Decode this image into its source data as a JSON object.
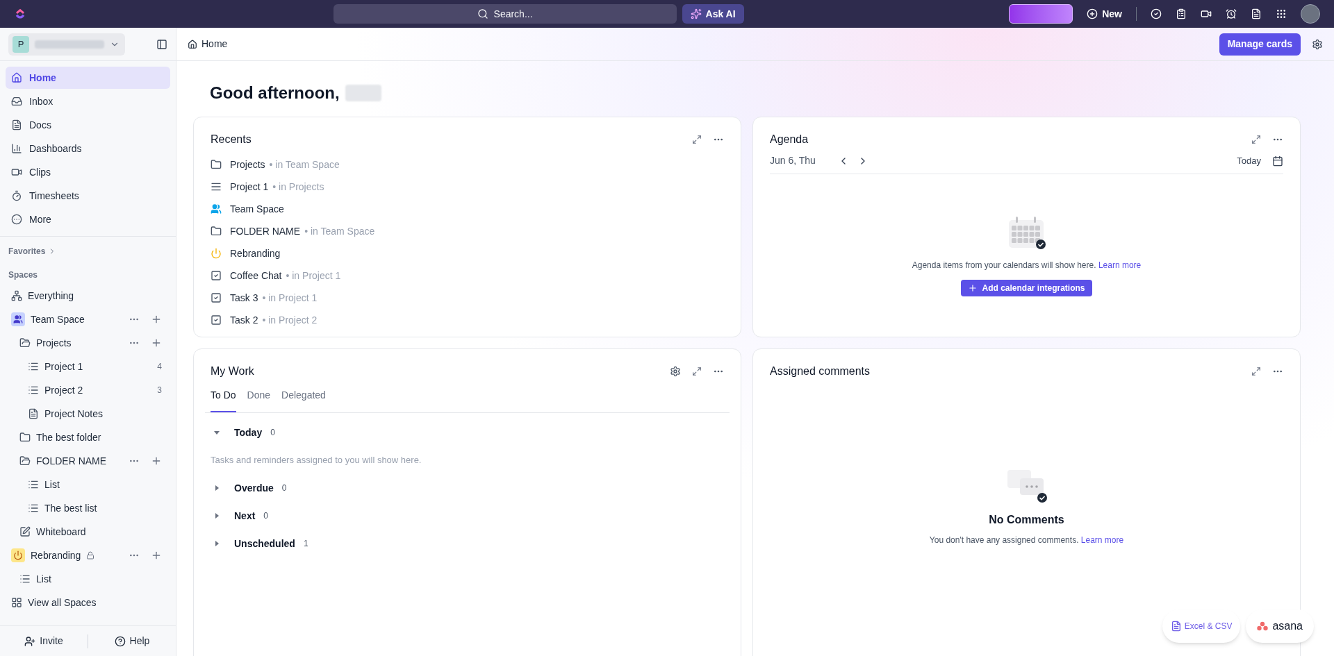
{
  "topbar": {
    "search": {
      "placeholder": "Search..."
    },
    "ask_ai": "Ask AI",
    "new": "New"
  },
  "sidebar": {
    "workspace": {
      "initial": "P"
    },
    "nav": [
      {
        "label": "Home",
        "kind": "home",
        "selected": true
      },
      {
        "label": "Inbox",
        "kind": "inbox",
        "selected": false
      },
      {
        "label": "Docs",
        "kind": "doc",
        "selected": false
      },
      {
        "label": "Dashboards",
        "kind": "chart",
        "selected": false
      },
      {
        "label": "Clips",
        "kind": "video",
        "selected": false
      },
      {
        "label": "Timesheets",
        "kind": "timer",
        "selected": false
      },
      {
        "label": "More",
        "kind": "more",
        "selected": false
      }
    ],
    "favorites": "Favorites",
    "spaces": "Spaces",
    "tree": [
      {
        "label": "Everything",
        "kind": "everything",
        "actions": false,
        "locked": false
      },
      {
        "label": "Team Space",
        "kind": "team",
        "actions": true,
        "locked": false,
        "children": [
          {
            "label": "Projects",
            "kind": "folder",
            "expanded": true,
            "actions": true,
            "locked": false,
            "children": [
              {
                "label": "Project 1",
                "kind": "list",
                "count": "4",
                "actions": false,
                "locked": false
              },
              {
                "label": "Project 2",
                "kind": "list",
                "count": "3",
                "actions": false,
                "locked": false
              },
              {
                "label": "Project Notes",
                "kind": "doc",
                "actions": false,
                "locked": false
              }
            ]
          },
          {
            "label": "The best folder",
            "kind": "folder",
            "expanded": false,
            "actions": false,
            "locked": false
          },
          {
            "label": "FOLDER NAME",
            "kind": "folder",
            "expanded": true,
            "actions": true,
            "locked": false,
            "children": [
              {
                "label": "List",
                "kind": "list",
                "actions": false,
                "locked": false
              },
              {
                "label": "The best list",
                "kind": "list",
                "actions": false,
                "locked": false
              }
            ]
          },
          {
            "label": "Whiteboard",
            "kind": "whiteboard",
            "actions": false,
            "locked": false
          }
        ]
      },
      {
        "label": "Rebranding",
        "kind": "power",
        "actions": true,
        "locked": true,
        "children": [
          {
            "label": "List",
            "kind": "list",
            "actions": false,
            "locked": false
          }
        ]
      },
      {
        "label": "View all Spaces",
        "kind": "grid",
        "actions": false,
        "locked": false
      }
    ],
    "footer": [
      "Invite",
      "Help"
    ]
  },
  "header": {
    "breadcrumb": "Home",
    "manage_cards": "Manage cards"
  },
  "greeting": "Good afternoon,",
  "recents": {
    "title": "Recents",
    "items": [
      {
        "title": "Projects",
        "location": "• in Team Space",
        "kind": "folder"
      },
      {
        "title": "Project 1",
        "location": "• in Projects",
        "kind": "list"
      },
      {
        "title": "Team Space",
        "kind": "space"
      },
      {
        "title": "FOLDER NAME",
        "location": "• in Team Space",
        "kind": "folder"
      },
      {
        "title": "Rebranding",
        "kind": "power"
      },
      {
        "title": "Coffee Chat",
        "location": "• in Project 1",
        "kind": "task"
      },
      {
        "title": "Task 3",
        "location": "• in Project 1",
        "kind": "task"
      },
      {
        "title": "Task 2",
        "location": "• in Project 2",
        "kind": "task"
      }
    ]
  },
  "agenda": {
    "title": "Agenda",
    "date": "Jun 6, Thu",
    "today": "Today",
    "empty_text": "Agenda items from your calendars will show here.",
    "link": "Learn more",
    "button": "Add calendar integrations"
  },
  "my_work": {
    "title": "My Work",
    "tabs": [
      {
        "label": "To Do",
        "selected": true
      },
      {
        "label": "Done",
        "selected": false
      },
      {
        "label": "Delegated",
        "selected": false
      }
    ],
    "groups": [
      {
        "label": "Today",
        "count": "0",
        "expanded": true,
        "empty_text": "Tasks and reminders assigned to you will show here."
      },
      {
        "label": "Overdue",
        "count": "0",
        "expanded": false
      },
      {
        "label": "Next",
        "count": "0",
        "expanded": false
      },
      {
        "label": "Unscheduled",
        "count": "1",
        "expanded": false
      }
    ]
  },
  "assigned_comments": {
    "title": "Assigned comments",
    "empty_title": "No Comments",
    "empty_text": "You don't have any assigned comments.",
    "link": "Learn more"
  },
  "floating": {
    "import": "Excel & CSV",
    "brand": "asana"
  }
}
